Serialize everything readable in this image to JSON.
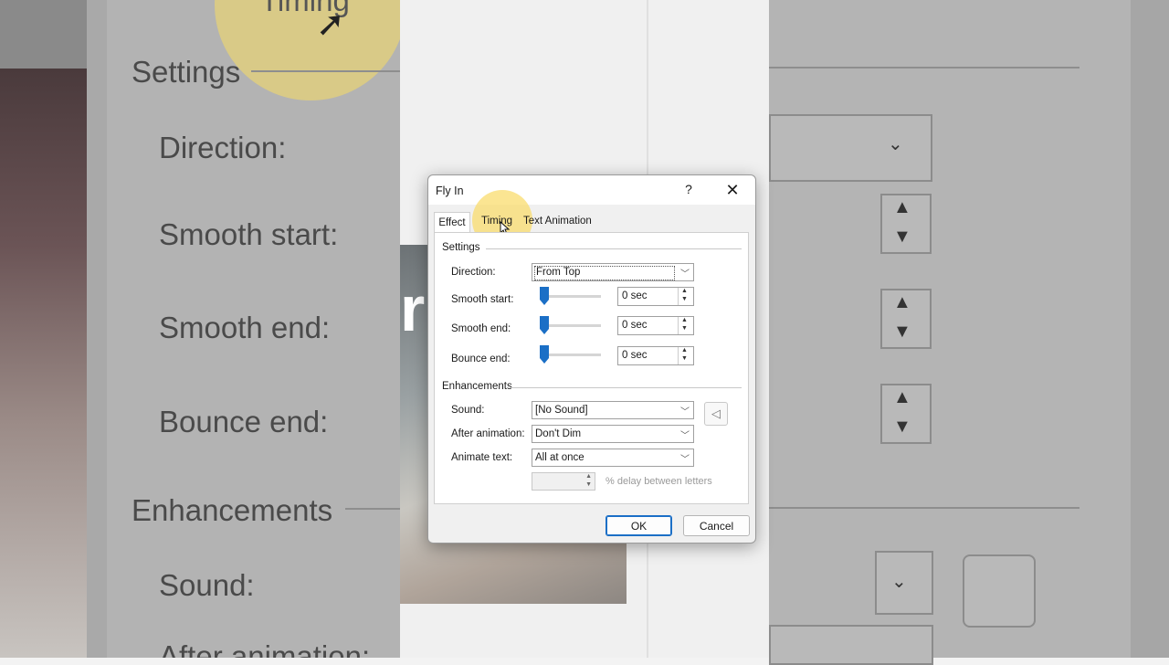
{
  "background": {
    "left_texts": [
      "Settings",
      "Direction:",
      "Smooth start:",
      "Smooth end:",
      "Bounce end:",
      "Enhancements",
      "Sound:",
      "After animation:",
      "Timing"
    ],
    "slide_fragment": "r"
  },
  "dialog": {
    "title": "Fly In",
    "help": "?",
    "close": "✕",
    "tabs": [
      "Effect",
      "Timing",
      "Text Animation"
    ],
    "settings": {
      "header": "Settings",
      "direction_label": "Direction:",
      "direction_value": "From Top",
      "smooth_start_label": "Smooth start:",
      "smooth_start_value": "0 sec",
      "smooth_end_label": "Smooth end:",
      "smooth_end_value": "0 sec",
      "bounce_end_label": "Bounce end:",
      "bounce_end_value": "0 sec"
    },
    "enhancements": {
      "header": "Enhancements",
      "sound_label": "Sound:",
      "sound_value": "[No Sound]",
      "after_label": "After animation:",
      "after_value": "Don't Dim",
      "animate_label": "Animate text:",
      "animate_value": "All at once",
      "delay_label": "% delay between letters"
    },
    "ok": "OK",
    "cancel": "Cancel"
  }
}
